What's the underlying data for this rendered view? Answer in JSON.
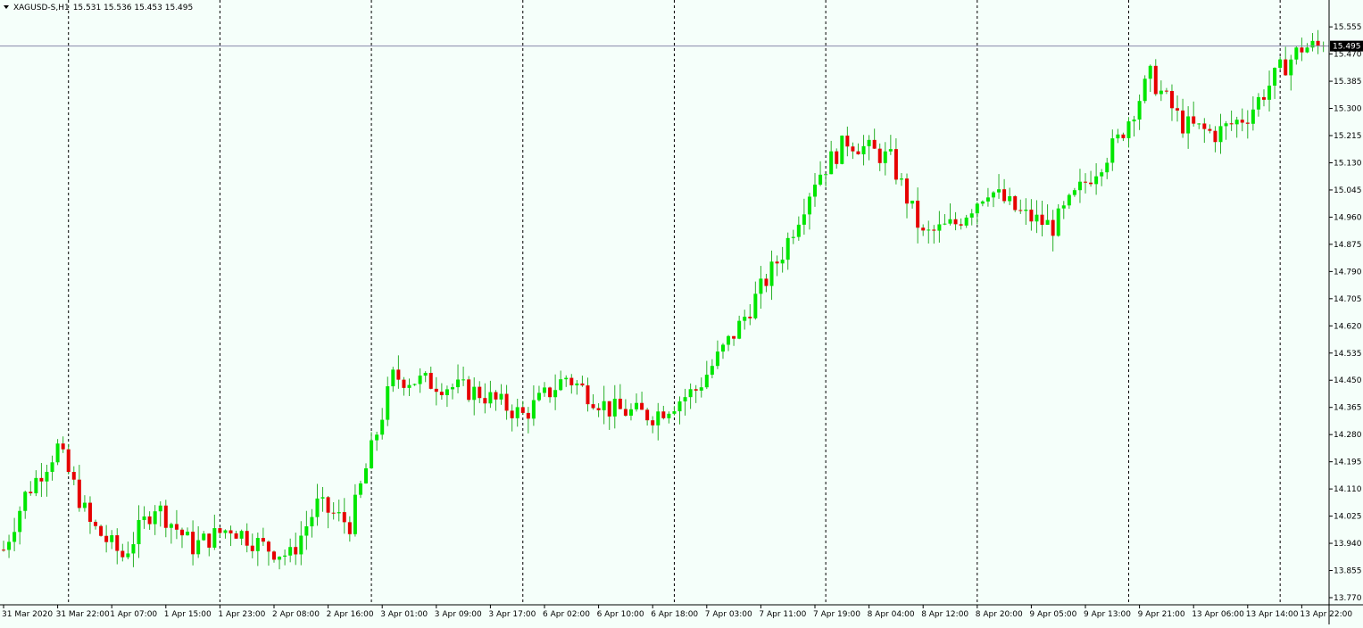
{
  "header": {
    "symbol": "XAGUSD-S,H1",
    "ohlc": "15.531 15.536 15.453 15.495",
    "icon": "triangle-down-icon"
  },
  "current_price": {
    "label": "15.495",
    "value": 15.495
  },
  "colors": {
    "background": "#f5fffa",
    "bull": "#00e600",
    "bear": "#e60000",
    "wick": "#2ab02a",
    "price_line": "#8888aa",
    "price_tag_bg": "#000000",
    "separator": "#000000"
  },
  "chart_data": {
    "type": "candlestick",
    "title": "XAGUSD-S,H1",
    "ylim": [
      13.77,
      15.6
    ],
    "y_ticks": [
      "15.555",
      "15.470",
      "15.385",
      "15.300",
      "15.215",
      "15.130",
      "15.045",
      "14.960",
      "14.875",
      "14.790",
      "14.705",
      "14.620",
      "14.535",
      "14.450",
      "14.365",
      "14.280",
      "14.195",
      "14.110",
      "14.025",
      "13.940",
      "13.855",
      "13.770"
    ],
    "x_labels": [
      "31 Mar 2020",
      "31 Mar 22:00",
      "1 Apr 07:00",
      "1 Apr 15:00",
      "1 Apr 23:00",
      "2 Apr 08:00",
      "2 Apr 16:00",
      "3 Apr 01:00",
      "3 Apr 09:00",
      "3 Apr 17:00",
      "6 Apr 02:00",
      "6 Apr 10:00",
      "6 Apr 18:00",
      "7 Apr 03:00",
      "7 Apr 11:00",
      "7 Apr 19:00",
      "8 Apr 04:00",
      "8 Apr 12:00",
      "8 Apr 20:00",
      "9 Apr 05:00",
      "9 Apr 13:00",
      "9 Apr 21:00",
      "13 Apr 06:00",
      "13 Apr 14:00",
      "13 Apr 22:00"
    ],
    "anchors": [
      [
        0,
        13.92
      ],
      [
        4,
        14.09
      ],
      [
        10,
        14.24
      ],
      [
        16,
        14.0
      ],
      [
        22,
        13.9
      ],
      [
        28,
        14.06
      ],
      [
        35,
        13.93
      ],
      [
        42,
        13.99
      ],
      [
        48,
        13.93
      ],
      [
        53,
        13.9
      ],
      [
        58,
        14.06
      ],
      [
        64,
        14.0
      ],
      [
        72,
        14.46
      ],
      [
        80,
        14.44
      ],
      [
        88,
        14.41
      ],
      [
        96,
        14.34
      ],
      [
        104,
        14.46
      ],
      [
        112,
        14.36
      ],
      [
        120,
        14.34
      ],
      [
        128,
        14.42
      ],
      [
        136,
        14.62
      ],
      [
        144,
        14.85
      ],
      [
        150,
        15.08
      ],
      [
        156,
        15.2
      ],
      [
        164,
        15.14
      ],
      [
        170,
        14.9
      ],
      [
        176,
        14.94
      ],
      [
        182,
        15.05
      ],
      [
        188,
        14.97
      ],
      [
        194,
        14.93
      ],
      [
        200,
        15.07
      ],
      [
        206,
        15.2
      ],
      [
        212,
        15.4
      ],
      [
        218,
        15.25
      ],
      [
        224,
        15.22
      ],
      [
        230,
        15.28
      ],
      [
        236,
        15.42
      ],
      [
        240,
        15.49
      ],
      [
        244,
        15.495
      ]
    ]
  }
}
